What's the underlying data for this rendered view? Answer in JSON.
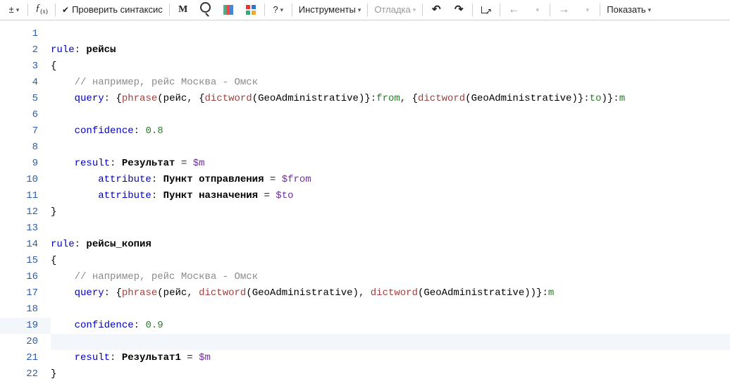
{
  "toolbar": {
    "plus_minus": "±",
    "fx": "ƒ",
    "check_syntax": "Проверить синтаксис",
    "m": "M",
    "help": "?",
    "tools": "Инструменты",
    "debug": "Отладка",
    "undo": "↶",
    "redo": "↷",
    "back": "←",
    "forward": "→",
    "show": "Показать"
  },
  "editor": {
    "line_numbers": [
      "1",
      "2",
      "3",
      "4",
      "5",
      "6",
      "7",
      "8",
      "9",
      "10",
      "11",
      "12",
      "13",
      "14",
      "15",
      "16",
      "17",
      "18",
      "19",
      "20",
      "21",
      "22"
    ],
    "current_line": 19
  },
  "code": {
    "l1_kw": "rule",
    "l1_name": "рейсы",
    "l2_brace": "{",
    "l3_comment": "// например, рейс Москва - Омск",
    "l4_kw": "query",
    "l4_phrase": "phrase",
    "l4_arg0": "рейс",
    "l4_dictword": "dictword",
    "l4_geo": "GeoAdministrative",
    "l4_from": "from",
    "l4_to": "to",
    "l4_m": "m",
    "l6_kw": "confidence",
    "l6_val": "0.8",
    "l8_kw": "result",
    "l8_name": "Результат",
    "l8_var": "$m",
    "l9_kw": "attribute",
    "l9_name": "Пункт отправления",
    "l9_var": "$from",
    "l10_kw": "attribute",
    "l10_name": "Пункт назначения",
    "l10_var": "$to",
    "l11_brace": "}",
    "l13_kw": "rule",
    "l13_name": "рейсы_копия",
    "l14_brace": "{",
    "l15_comment": "// например, рейс Москва - Омск",
    "l16_kw": "query",
    "l16_phrase": "phrase",
    "l16_arg0": "рейс",
    "l16_dictword": "dictword",
    "l16_geo": "GeoAdministrative",
    "l16_m": "m",
    "l18_kw": "confidence",
    "l18_val": "0.9",
    "l20_kw": "result",
    "l20_name": "Результат1",
    "l20_var": "$m",
    "l21_brace": "}"
  }
}
